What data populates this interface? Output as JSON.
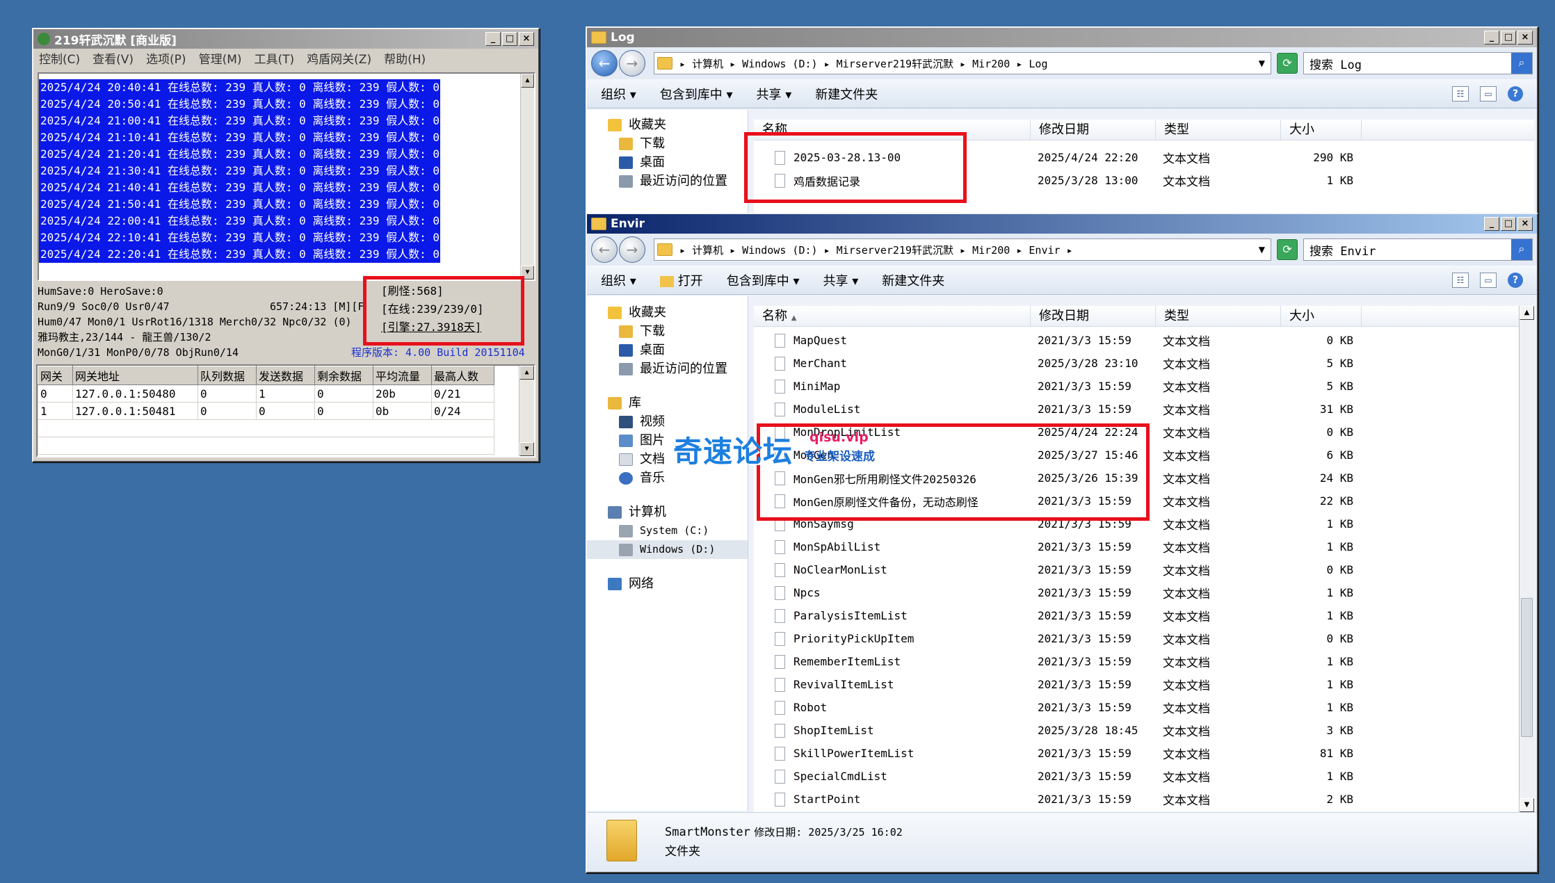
{
  "server_window": {
    "title": "219轩武沉默 [商业版]",
    "menu": [
      "控制(C)",
      "查看(V)",
      "选项(P)",
      "管理(M)",
      "工具(T)",
      "鸡盾网关(Z)",
      "帮助(H)"
    ],
    "log_lines": [
      "2025/4/24 20:40:41 在线总数: 239 真人数: 0 离线数: 239 假人数: 0",
      "2025/4/24 20:50:41 在线总数: 239 真人数: 0 离线数: 239 假人数: 0",
      "2025/4/24 21:00:41 在线总数: 239 真人数: 0 离线数: 239 假人数: 0",
      "2025/4/24 21:10:41 在线总数: 239 真人数: 0 离线数: 239 假人数: 0",
      "2025/4/24 21:20:41 在线总数: 239 真人数: 0 离线数: 239 假人数: 0",
      "2025/4/24 21:30:41 在线总数: 239 真人数: 0 离线数: 239 假人数: 0",
      "2025/4/24 21:40:41 在线总数: 239 真人数: 0 离线数: 239 假人数: 0",
      "2025/4/24 21:50:41 在线总数: 239 真人数: 0 离线数: 239 假人数: 0",
      "2025/4/24 22:00:41 在线总数: 239 真人数: 0 离线数: 239 假人数: 0",
      "2025/4/24 22:10:41 在线总数: 239 真人数: 0 离线数: 239 假人数: 0",
      "2025/4/24 22:20:41 在线总数: 239 真人数: 0 离线数: 239 假人数: 0"
    ],
    "status_lines": [
      "HumSave:0 HeroSave:0",
      "Run9/9 Soc0/0 Usr0/47",
      "Hum0/47 Mon0/1 UsrRot16/1318 Merch0/32 Npc0/32 (0)",
      "雅玛教主,23/144 - 龍王兽/130/2",
      "MonG0/1/31 MonP0/0/78 ObjRun0/14"
    ],
    "uptime": "657:24:13 [M][F",
    "version": "程序版本: 4.00 Build 20151104",
    "counters": [
      "[刷怪:568]",
      "[在线:239/239/0]",
      "[引擎:27.3918天]"
    ],
    "gate_columns": [
      "网关",
      "网关地址",
      "队列数据",
      "发送数据",
      "剩余数据",
      "平均流量",
      "最高人数"
    ],
    "gate_rows": [
      [
        "0",
        "127.0.0.1:50480",
        "0",
        "1",
        "0",
        "20b",
        "0/21"
      ],
      [
        "1",
        "127.0.0.1:50481",
        "0",
        "0",
        "0",
        "0b",
        "0/24"
      ]
    ]
  },
  "log_window": {
    "title": "Log",
    "address": [
      "计算机",
      "Windows (D:)",
      "Mirserver219轩武沉默",
      "Mir200",
      "Log"
    ],
    "search_placeholder": "搜索 Log",
    "toolbar": [
      "组织 ▾",
      "包含到库中 ▾",
      "共享 ▾",
      "新建文件夹"
    ],
    "nav": [
      "收藏夹",
      "下载",
      "桌面",
      "最近访问的位置"
    ],
    "columns": [
      "名称",
      "修改日期",
      "类型",
      "大小"
    ],
    "files": [
      {
        "name": "2025-03-28.13-00",
        "date": "2025/4/24 22:20",
        "type": "文本文档",
        "size": "290 KB"
      },
      {
        "name": "鸡盾数据记录",
        "date": "2025/3/28 13:00",
        "type": "文本文档",
        "size": "1 KB"
      }
    ]
  },
  "envir_window": {
    "title": "Envir",
    "address": [
      "计算机",
      "Windows (D:)",
      "Mirserver219轩武沉默",
      "Mir200",
      "Envir"
    ],
    "search_placeholder": "搜索 Envir",
    "toolbar": [
      "组织 ▾",
      "打开",
      "包含到库中 ▾",
      "共享 ▾",
      "新建文件夹"
    ],
    "nav": {
      "favorites": [
        "收藏夹",
        "下载",
        "桌面",
        "最近访问的位置"
      ],
      "libraries": [
        "库",
        "视频",
        "图片",
        "文档",
        "音乐"
      ],
      "computer": [
        "计算机",
        "System (C:)",
        "Windows (D:)"
      ],
      "network": "网络"
    },
    "columns": [
      "名称",
      "修改日期",
      "类型",
      "大小"
    ],
    "files": [
      {
        "name": "MapQuest",
        "date": "2021/3/3 15:59",
        "type": "文本文档",
        "size": "0 KB"
      },
      {
        "name": "MerChant",
        "date": "2025/3/28 23:10",
        "type": "文本文档",
        "size": "5 KB"
      },
      {
        "name": "MiniMap",
        "date": "2021/3/3 15:59",
        "type": "文本文档",
        "size": "5 KB"
      },
      {
        "name": "ModuleList",
        "date": "2021/3/3 15:59",
        "type": "文本文档",
        "size": "31 KB"
      },
      {
        "name": "MonDropLimitList",
        "date": "2025/4/24 22:24",
        "type": "文本文档",
        "size": "0 KB"
      },
      {
        "name": "MonGen",
        "date": "2025/3/27 15:46",
        "type": "文本文档",
        "size": "6 KB"
      },
      {
        "name": "MonGen邪七所用刷怪文件20250326",
        "date": "2025/3/26 15:39",
        "type": "文本文档",
        "size": "24 KB"
      },
      {
        "name": "MonGen原刷怪文件备份，无动态刷怪",
        "date": "2021/3/3 15:59",
        "type": "文本文档",
        "size": "22 KB"
      },
      {
        "name": "MonSaymsg",
        "date": "2021/3/3 15:59",
        "type": "文本文档",
        "size": "1 KB"
      },
      {
        "name": "MonSpAbilList",
        "date": "2021/3/3 15:59",
        "type": "文本文档",
        "size": "1 KB"
      },
      {
        "name": "NoClearMonList",
        "date": "2021/3/3 15:59",
        "type": "文本文档",
        "size": "0 KB"
      },
      {
        "name": "Npcs",
        "date": "2021/3/3 15:59",
        "type": "文本文档",
        "size": "1 KB"
      },
      {
        "name": "ParalysisItemList",
        "date": "2021/3/3 15:59",
        "type": "文本文档",
        "size": "1 KB"
      },
      {
        "name": "PriorityPickUpItem",
        "date": "2021/3/3 15:59",
        "type": "文本文档",
        "size": "0 KB"
      },
      {
        "name": "RememberItemList",
        "date": "2021/3/3 15:59",
        "type": "文本文档",
        "size": "1 KB"
      },
      {
        "name": "RevivalItemList",
        "date": "2021/3/3 15:59",
        "type": "文本文档",
        "size": "1 KB"
      },
      {
        "name": "Robot",
        "date": "2021/3/3 15:59",
        "type": "文本文档",
        "size": "1 KB"
      },
      {
        "name": "ShopItemList",
        "date": "2025/3/28 18:45",
        "type": "文本文档",
        "size": "3 KB"
      },
      {
        "name": "SkillPowerItemList",
        "date": "2021/3/3 15:59",
        "type": "文本文档",
        "size": "81 KB"
      },
      {
        "name": "SpecialCmdList",
        "date": "2021/3/3 15:59",
        "type": "文本文档",
        "size": "1 KB"
      },
      {
        "name": "StartPoint",
        "date": "2021/3/3 15:59",
        "type": "文本文档",
        "size": "2 KB"
      }
    ],
    "details": {
      "name": "SmartMonster",
      "date_label": "修改日期: 2025/3/25 16:02",
      "type": "文件夹"
    }
  },
  "watermark": {
    "main": "奇速论坛",
    "url": "qisu.vip",
    "sub": "专业架设速成"
  },
  "colors": {
    "desktop": "#3a6ea5",
    "log_highlight": "#0a18e8",
    "annotation_red": "#e8101c",
    "active_title": "#0a246a"
  }
}
